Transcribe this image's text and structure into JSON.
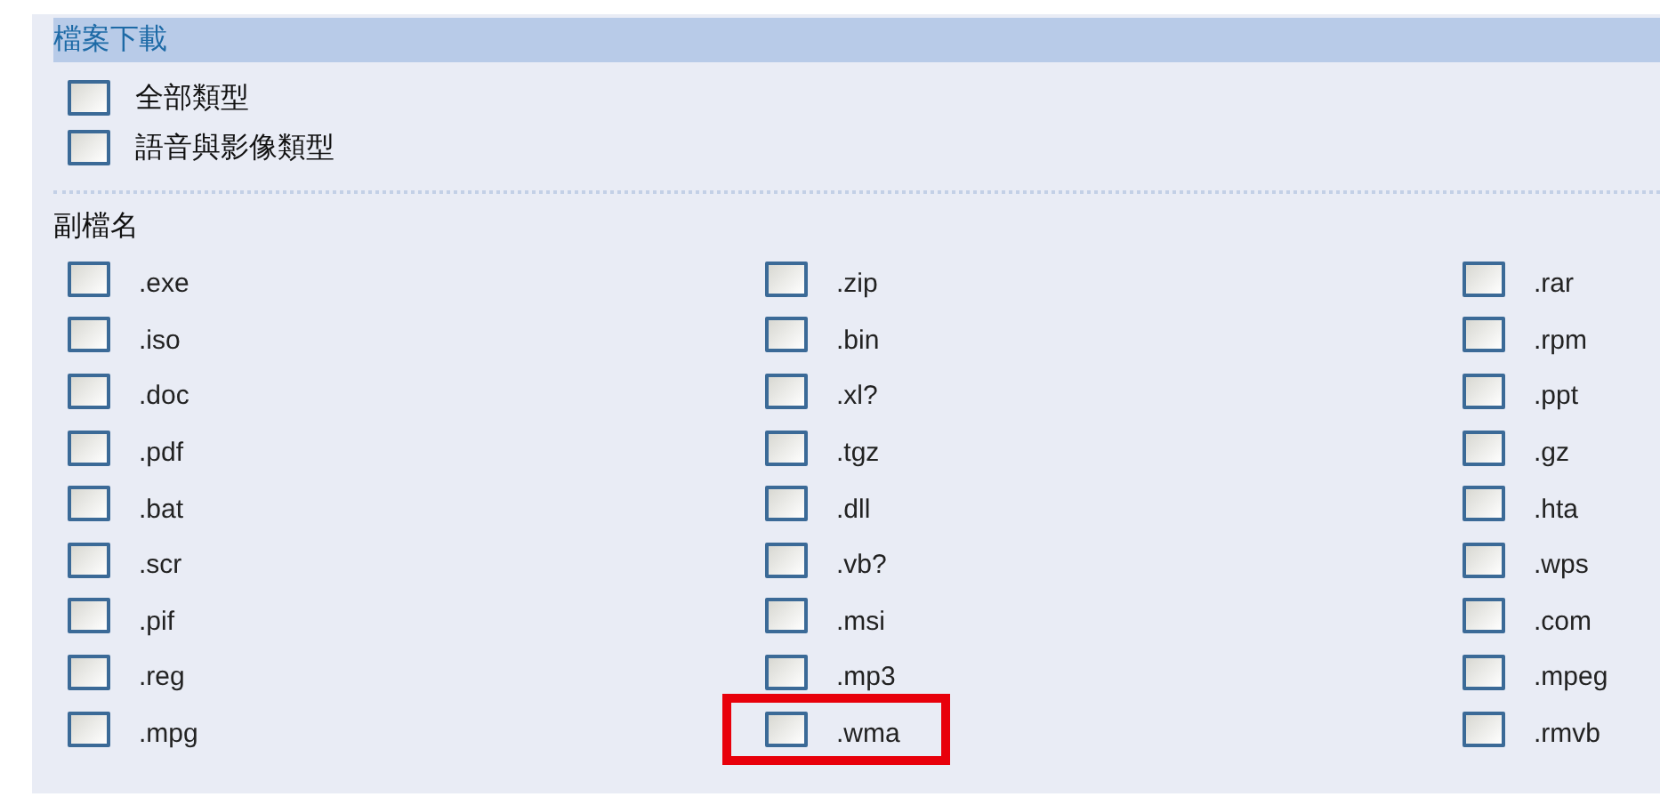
{
  "section_title": "檔案下載",
  "type_options": [
    {
      "label": "全部類型",
      "checked": false
    },
    {
      "label": "語音與影像類型",
      "checked": false
    }
  ],
  "extensions_title": "副檔名",
  "extensions": [
    {
      "label": ".exe",
      "checked": false,
      "highlighted": false
    },
    {
      "label": ".zip",
      "checked": false,
      "highlighted": false
    },
    {
      "label": ".rar",
      "checked": false,
      "highlighted": false
    },
    {
      "label": ".iso",
      "checked": false,
      "highlighted": false
    },
    {
      "label": ".bin",
      "checked": false,
      "highlighted": false
    },
    {
      "label": ".rpm",
      "checked": false,
      "highlighted": false
    },
    {
      "label": ".doc",
      "checked": false,
      "highlighted": false
    },
    {
      "label": ".xl?",
      "checked": false,
      "highlighted": false
    },
    {
      "label": ".ppt",
      "checked": false,
      "highlighted": false
    },
    {
      "label": ".pdf",
      "checked": false,
      "highlighted": false
    },
    {
      "label": ".tgz",
      "checked": false,
      "highlighted": false
    },
    {
      "label": ".gz",
      "checked": false,
      "highlighted": false
    },
    {
      "label": ".bat",
      "checked": false,
      "highlighted": false
    },
    {
      "label": ".dll",
      "checked": false,
      "highlighted": false
    },
    {
      "label": ".hta",
      "checked": false,
      "highlighted": false
    },
    {
      "label": ".scr",
      "checked": false,
      "highlighted": false
    },
    {
      "label": ".vb?",
      "checked": false,
      "highlighted": false
    },
    {
      "label": ".wps",
      "checked": false,
      "highlighted": false
    },
    {
      "label": ".pif",
      "checked": false,
      "highlighted": false
    },
    {
      "label": ".msi",
      "checked": false,
      "highlighted": false
    },
    {
      "label": ".com",
      "checked": false,
      "highlighted": false
    },
    {
      "label": ".reg",
      "checked": false,
      "highlighted": false
    },
    {
      "label": ".mp3",
      "checked": false,
      "highlighted": false
    },
    {
      "label": ".mpeg",
      "checked": false,
      "highlighted": false
    },
    {
      "label": ".mpg",
      "checked": false,
      "highlighted": false
    },
    {
      "label": ".wma",
      "checked": false,
      "highlighted": true
    },
    {
      "label": ".rmvb",
      "checked": false,
      "highlighted": false
    }
  ]
}
